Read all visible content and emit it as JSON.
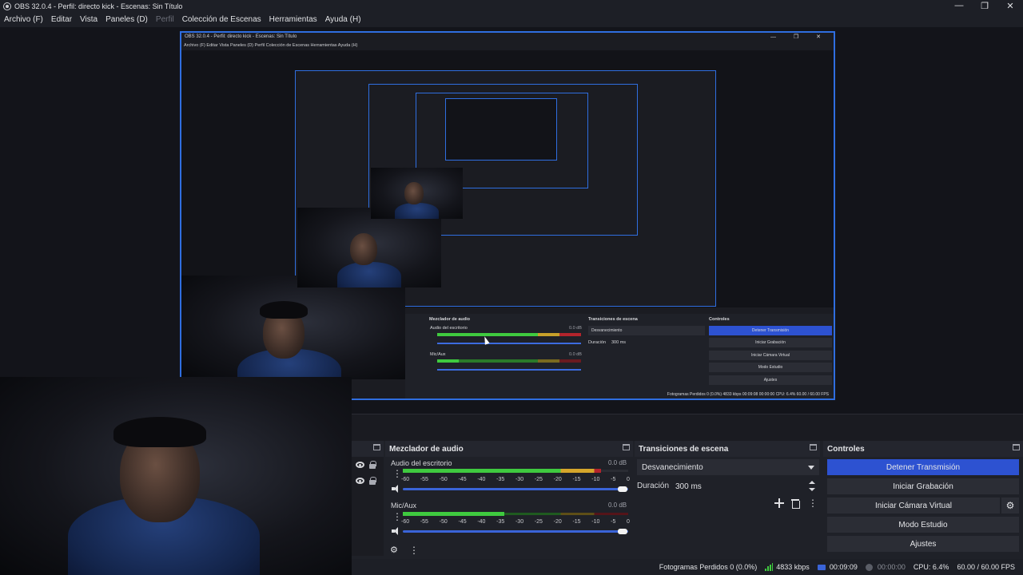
{
  "window": {
    "title": "OBS 32.0.4 - Perfil: directo kick - Escenas: Sin Título",
    "controls": {
      "minimize": "—",
      "maximize": "❐",
      "close": "✕"
    }
  },
  "menu": {
    "items": [
      {
        "label": "Archivo (F)"
      },
      {
        "label": "Editar"
      },
      {
        "label": "Vista"
      },
      {
        "label": "Paneles (D)"
      },
      {
        "label": "Perfil"
      },
      {
        "label": "Colección de Escenas"
      },
      {
        "label": "Herramientas"
      },
      {
        "label": "Ayuda (H)"
      }
    ]
  },
  "nested": {
    "title": "OBS 32.0.4 - Perfil: directo kick - Escenas: Sin Título",
    "menu": "Archivo (F)   Editar   Vista   Paneles (D)   Perfil   Colección de Escenas   Herramientas   Ayuda (H)",
    "controls": "— ❐ ✕",
    "mixer_title": "Mezclador de audio",
    "transitions_title": "Transiciones de escena",
    "controls_title": "Controles",
    "desktop_audio": "Audio del escritorio",
    "mic": "Mic/Aux",
    "db": "0.0 dB",
    "transition": "Desvanecimiento",
    "duration_label": "Duración",
    "duration_value": "300 ms",
    "btn_stop": "Detener Transmisión",
    "btn_record": "Iniciar Grabación",
    "btn_vcam": "Iniciar Cámara Virtual",
    "btn_studio": "Modo Estudio",
    "btn_settings": "Ajustes",
    "status": "Fotogramas Perdidos 0 (0.0%)   4833 kbps   00:09:08   00:00:00   CPU: 6.4%   60.00 / 60.00 FPS"
  },
  "mixer": {
    "title": "Mezclador de audio",
    "channels": [
      {
        "name": "Audio del escritorio",
        "db": "0.0 dB"
      },
      {
        "name": "Mic/Aux",
        "db": "0.0 dB"
      }
    ],
    "ticks": [
      "-60",
      "-55",
      "-50",
      "-45",
      "-40",
      "-35",
      "-30",
      "-25",
      "-20",
      "-15",
      "-10",
      "-5",
      "0"
    ],
    "colors": {
      "green": "#3fca3f",
      "yellow": "#d6a62b",
      "red": "#b3242c"
    },
    "levels": {
      "desktop": 0.88,
      "mic": 0.45
    }
  },
  "transitions": {
    "title": "Transiciones de escena",
    "selected": "Desvanecimiento",
    "duration_label": "Duración",
    "duration_value": "300 ms"
  },
  "controls": {
    "title": "Controles",
    "stop_stream": "Detener Transmisión",
    "start_recording": "Iniciar Grabación",
    "start_virtual_cam": "Iniciar Cámara Virtual",
    "studio_mode": "Modo Estudio",
    "settings": "Ajustes",
    "accent": "#2d52d1"
  },
  "status": {
    "dropped_frames": "Fotogramas Perdidos 0 (0.0%)",
    "bitrate": "4833 kbps",
    "stream_time": "00:09:09",
    "record_time": "00:00:00",
    "cpu": "CPU: 6.4%",
    "fps": "60.00 / 60.00 FPS"
  }
}
